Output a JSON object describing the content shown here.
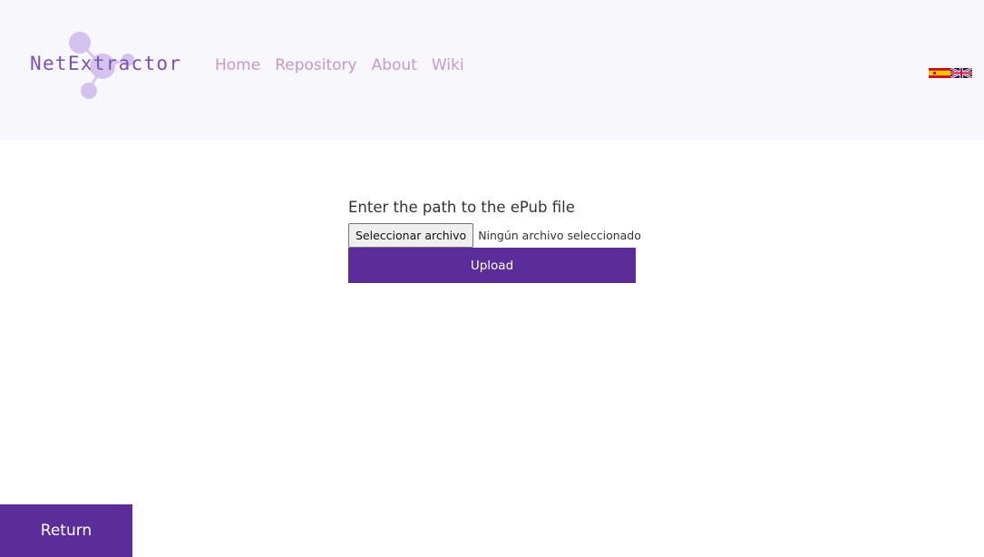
{
  "brand": {
    "name": "NetExtractor",
    "logo_icon": "molecule-network-icon"
  },
  "nav": {
    "items": [
      {
        "label": "Home"
      },
      {
        "label": "Repository"
      },
      {
        "label": "About"
      },
      {
        "label": "Wiki"
      }
    ]
  },
  "languages": [
    {
      "code": "es",
      "icon": "spain-flag-icon"
    },
    {
      "code": "en",
      "icon": "uk-flag-icon"
    }
  ],
  "upload_form": {
    "label": "Enter the path to the ePub file",
    "file_button": "Seleccionar archivo",
    "file_status": "Ningún archivo seleccionado",
    "submit_label": "Upload"
  },
  "footer": {
    "return_label": "Return"
  },
  "colors": {
    "primary": "#5b2d98",
    "nav_link": "#c49ac8",
    "header_bg": "#f8f7fb",
    "logo_text": "#7b52b8",
    "logo_nodes": "#d4c3ee"
  }
}
